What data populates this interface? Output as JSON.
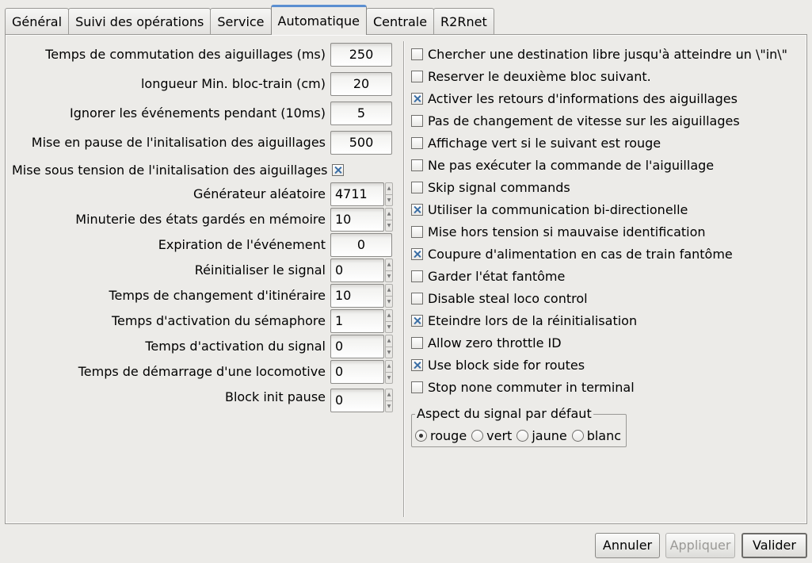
{
  "tabs": [
    {
      "label": "Général",
      "active": false
    },
    {
      "label": "Suivi des opérations",
      "active": false
    },
    {
      "label": "Service",
      "active": false
    },
    {
      "label": "Automatique",
      "active": true
    },
    {
      "label": "Centrale",
      "active": false
    },
    {
      "label": "R2Rnet",
      "active": false
    }
  ],
  "left": {
    "fields": [
      {
        "label": "Temps de commutation des aiguillages (ms)",
        "value": "250"
      },
      {
        "label": "longueur Min. bloc-train (cm)",
        "value": "20"
      },
      {
        "label": "Ignorer les événements pendant (10ms)",
        "value": "5"
      },
      {
        "label": "Mise en pause de l'initalisation des aiguillages",
        "value": "500"
      }
    ],
    "power_check": {
      "label": "Mise sous tension de l'initalisation des aiguillages",
      "checked": true
    },
    "spin1": {
      "label": "Générateur aléatoire",
      "value": "4711"
    },
    "spin2": {
      "label": "Minuterie des états gardés en mémoire",
      "value": "10"
    },
    "event_expiry": {
      "label": "Expiration de l'événement",
      "value": "0"
    },
    "spins": [
      {
        "label": "Réinitialiser le signal",
        "value": "0"
      },
      {
        "label": "Temps de changement d'itinéraire",
        "value": "10"
      },
      {
        "label": "Temps d'activation du sémaphore",
        "value": "1"
      },
      {
        "label": "Temps d'activation du signal",
        "value": "0"
      },
      {
        "label": "Temps de démarrage d'une locomotive",
        "value": "0"
      },
      {
        "label": "Block init pause",
        "value": "0"
      }
    ]
  },
  "right": {
    "checks": [
      {
        "label": "Chercher une destination libre jusqu'à atteindre un \\\"in\\\"",
        "checked": false
      },
      {
        "label": "Reserver le deuxième bloc suivant.",
        "checked": false
      },
      {
        "label": "Activer les retours d'informations des aiguillages",
        "checked": true
      },
      {
        "label": "Pas de changement de vitesse sur les aiguillages",
        "checked": false
      },
      {
        "label": "Affichage vert si le suivant est rouge",
        "checked": false
      },
      {
        "label": "Ne pas exécuter la commande de l'aiguillage",
        "checked": false
      },
      {
        "label": "Skip signal commands",
        "checked": false
      },
      {
        "label": "Utiliser la communication bi-directionelle",
        "checked": true
      },
      {
        "label": "Mise hors tension si mauvaise identification",
        "checked": false
      },
      {
        "label": "Coupure d'alimentation en cas de train fantôme",
        "checked": true
      },
      {
        "label": "Garder l'état fantôme",
        "checked": false
      },
      {
        "label": "Disable steal loco control",
        "checked": false
      },
      {
        "label": "Eteindre lors de la réinitialisation",
        "checked": true
      },
      {
        "label": "Allow zero throttle ID",
        "checked": false
      },
      {
        "label": "Use block side for routes",
        "checked": true
      },
      {
        "label": "Stop none commuter in terminal",
        "checked": false
      }
    ],
    "signal_group": {
      "title": "Aspect du signal par défaut",
      "options": [
        {
          "label": "rouge",
          "selected": true
        },
        {
          "label": "vert",
          "selected": false
        },
        {
          "label": "jaune",
          "selected": false
        },
        {
          "label": "blanc",
          "selected": false
        }
      ]
    }
  },
  "buttons": {
    "cancel": "Annuler",
    "apply": "Appliquer",
    "ok": "Valider"
  }
}
